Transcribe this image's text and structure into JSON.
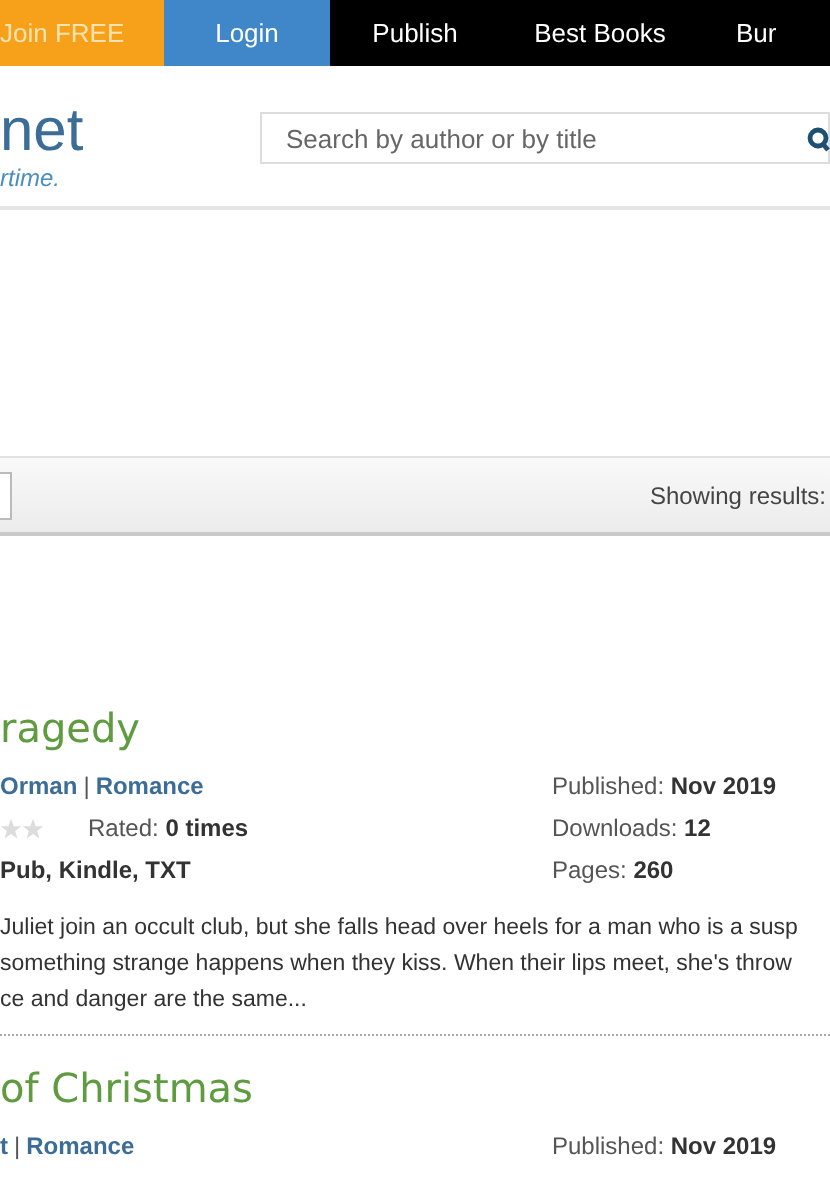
{
  "nav": [
    {
      "label": "Join FREE",
      "color": "#f7a11a"
    },
    {
      "label": "Login",
      "color": "#3f87c8"
    },
    {
      "label": "Publish",
      "color": "#000000"
    },
    {
      "label": "Best Books",
      "color": "#000000"
    },
    {
      "label": "Bur",
      "color": "#000000"
    }
  ],
  "logo": {
    "name": "net",
    "tagline": "rtime."
  },
  "search": {
    "placeholder": "Search by author or by title"
  },
  "toolbar": {
    "results_label": "Showing results:"
  },
  "books": [
    {
      "title": "ragedy",
      "author": "Orman",
      "separator": "|",
      "genre": "Romance",
      "rated": "Rated: **0 times**",
      "formats": "Pub, Kindle, TXT",
      "published": "Published: **Nov 2019**",
      "downloads": "Downloads: **12**",
      "pages": "Pages: **260**",
      "description": [
        "Juliet join an occult club, but she falls head over heels for a man who is a susp",
        "something strange happens when they kiss. When their lips meet, she's throw",
        "ce and danger are the same..."
      ]
    },
    {
      "title": "of Christmas",
      "author": "t",
      "separator": "|",
      "genre": "Romance",
      "published": "Published: **Nov 2019**"
    }
  ]
}
